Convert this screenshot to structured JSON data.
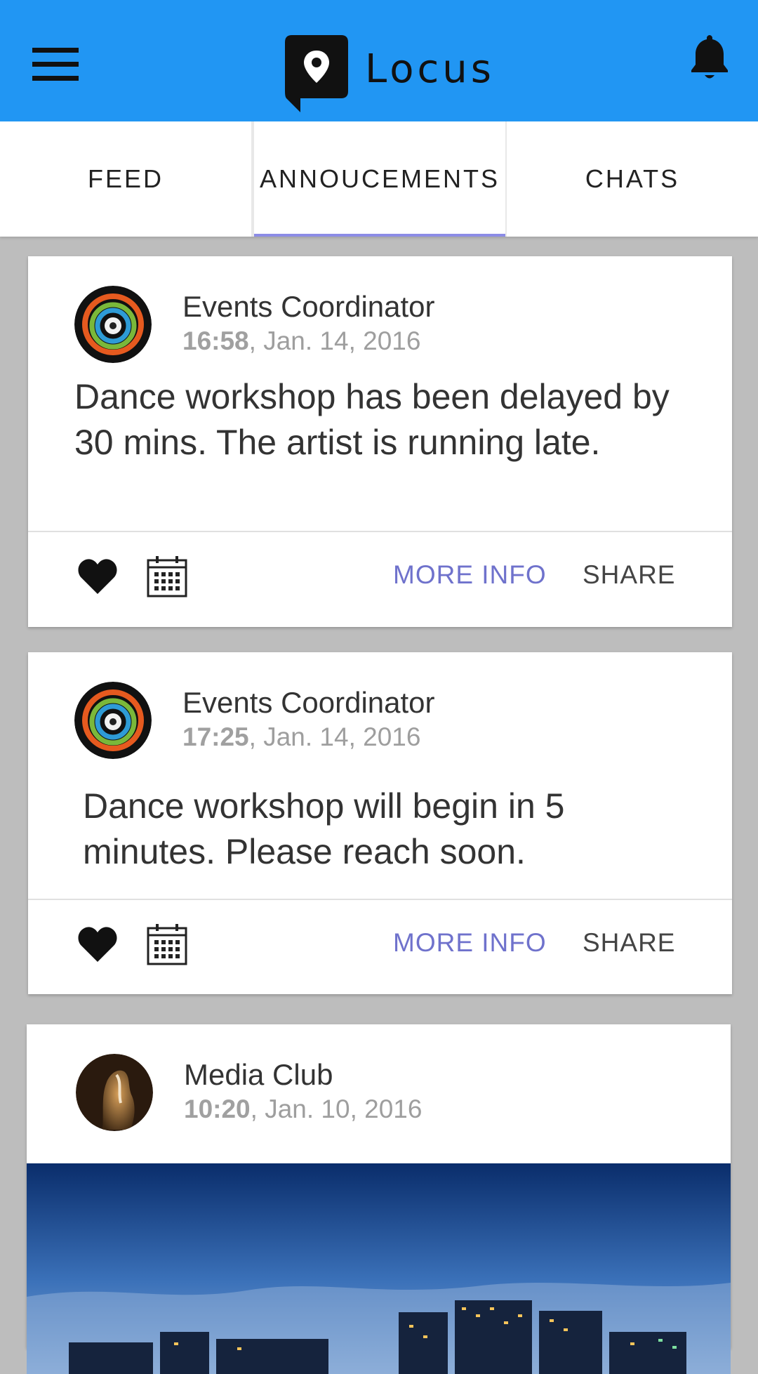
{
  "app": {
    "title": "Locus",
    "colors": {
      "appbar": "#2196f3",
      "accent": "#6f72cc",
      "tab_indicator": "#8c8ce6"
    },
    "icons": {
      "menu": "menu-icon",
      "logo": "map-pin-logo-icon",
      "notifications": "bell-icon"
    }
  },
  "tabs": [
    {
      "label": "FEED",
      "active": false
    },
    {
      "label": "ANNOUCEMENTS",
      "active": true
    },
    {
      "label": "CHATS",
      "active": false
    }
  ],
  "posts": [
    {
      "author": "Events Coordinator",
      "time": "16:58",
      "date": ", Jan. 14, 2016",
      "body": "Dance workshop has been delayed by 30 mins. The artist is running late.",
      "more_info": "MORE INFO",
      "share": "SHARE"
    },
    {
      "author": "Events Coordinator",
      "time": "17:25",
      "date": ", Jan. 14, 2016",
      "body": "Dance workshop will begin in 5 minutes. Please reach soon.",
      "more_info": "MORE INFO",
      "share": "SHARE"
    },
    {
      "author": "Media Club",
      "time": "10:20",
      "date": ", Jan. 10, 2016"
    }
  ]
}
